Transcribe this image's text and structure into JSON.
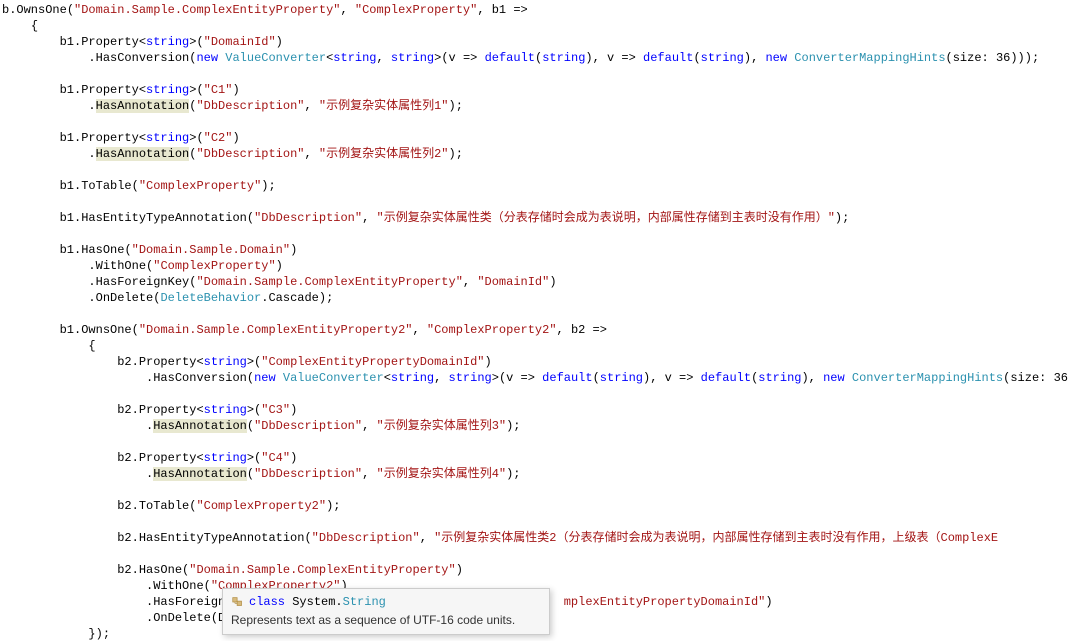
{
  "kw": {
    "new": "new",
    "string": "string",
    "default": "default",
    "class": "class"
  },
  "types": {
    "ValueConverter": "ValueConverter",
    "ConverterMappingHints": "ConverterMappingHints",
    "DeleteBehavior": "DeleteBehavior"
  },
  "ids": {
    "b": "b",
    "b1": "b1",
    "b2": "b2",
    "OwnsOne": "OwnsOne",
    "Property": "Property",
    "HasConversion": "HasConversion",
    "HasAnnotation": "HasAnnotation",
    "ToTable": "ToTable",
    "HasEntityTypeAnnotation": "HasEntityTypeAnnotation",
    "HasOne": "HasOne",
    "WithOne": "WithOne",
    "HasForeignKey": "HasForeignKey",
    "OnDelete": "OnDelete",
    "Cascade": "Cascade",
    "size": "size",
    "v": "v"
  },
  "nums": {
    "thirtySix": "36"
  },
  "str": {
    "ownsOne1_a": "\"Domain.Sample.ComplexEntityProperty\"",
    "ownsOne1_b": "\"ComplexProperty\"",
    "DomainId": "\"DomainId\"",
    "C1": "\"C1\"",
    "C2": "\"C2\"",
    "C3": "\"C3\"",
    "C4": "\"C4\"",
    "DbDescription": "\"DbDescription\"",
    "col1": "\"示例复杂实体属性列1\"",
    "col2": "\"示例复杂实体属性列2\"",
    "col3": "\"示例复杂实体属性列3\"",
    "col4": "\"示例复杂实体属性列4\"",
    "ComplexProperty": "\"ComplexProperty\"",
    "ComplexProperty2": "\"ComplexProperty2\"",
    "entAnn1": "\"示例复杂实体属性类（分表存储时会成为表说明，内部属性存储到主表时没有作用）\"",
    "entAnn2_partial": "\"示例复杂实体属性类2（分表存储时会成为表说明，内部属性存储到主表时没有作用，上级表（ComplexE",
    "hasOne1": "\"Domain.Sample.Domain\"",
    "fk1_a": "\"Domain.Sample.ComplexEntityProperty\"",
    "fk1_b": "\"DomainId\"",
    "ownsOne2_a": "\"Domain.Sample.ComplexEntityProperty2\"",
    "ownsOne2_b": "\"ComplexProperty2\"",
    "cepDomainId": "\"ComplexEntityPropertyDomainId\"",
    "hasOne2": "\"Domain.Sample.ComplexEntityProperty\"",
    "fk2_tail": "mplexEntityPropertyDomainId\""
  },
  "frag": {
    "hasForeignK": "HasForeignK",
    "onDeleteD": "OnDelete(D"
  },
  "tooltip": {
    "kw": "class",
    "ns": "System.",
    "type": "String",
    "desc": "Represents text as a sequence of UTF-16 code units."
  }
}
